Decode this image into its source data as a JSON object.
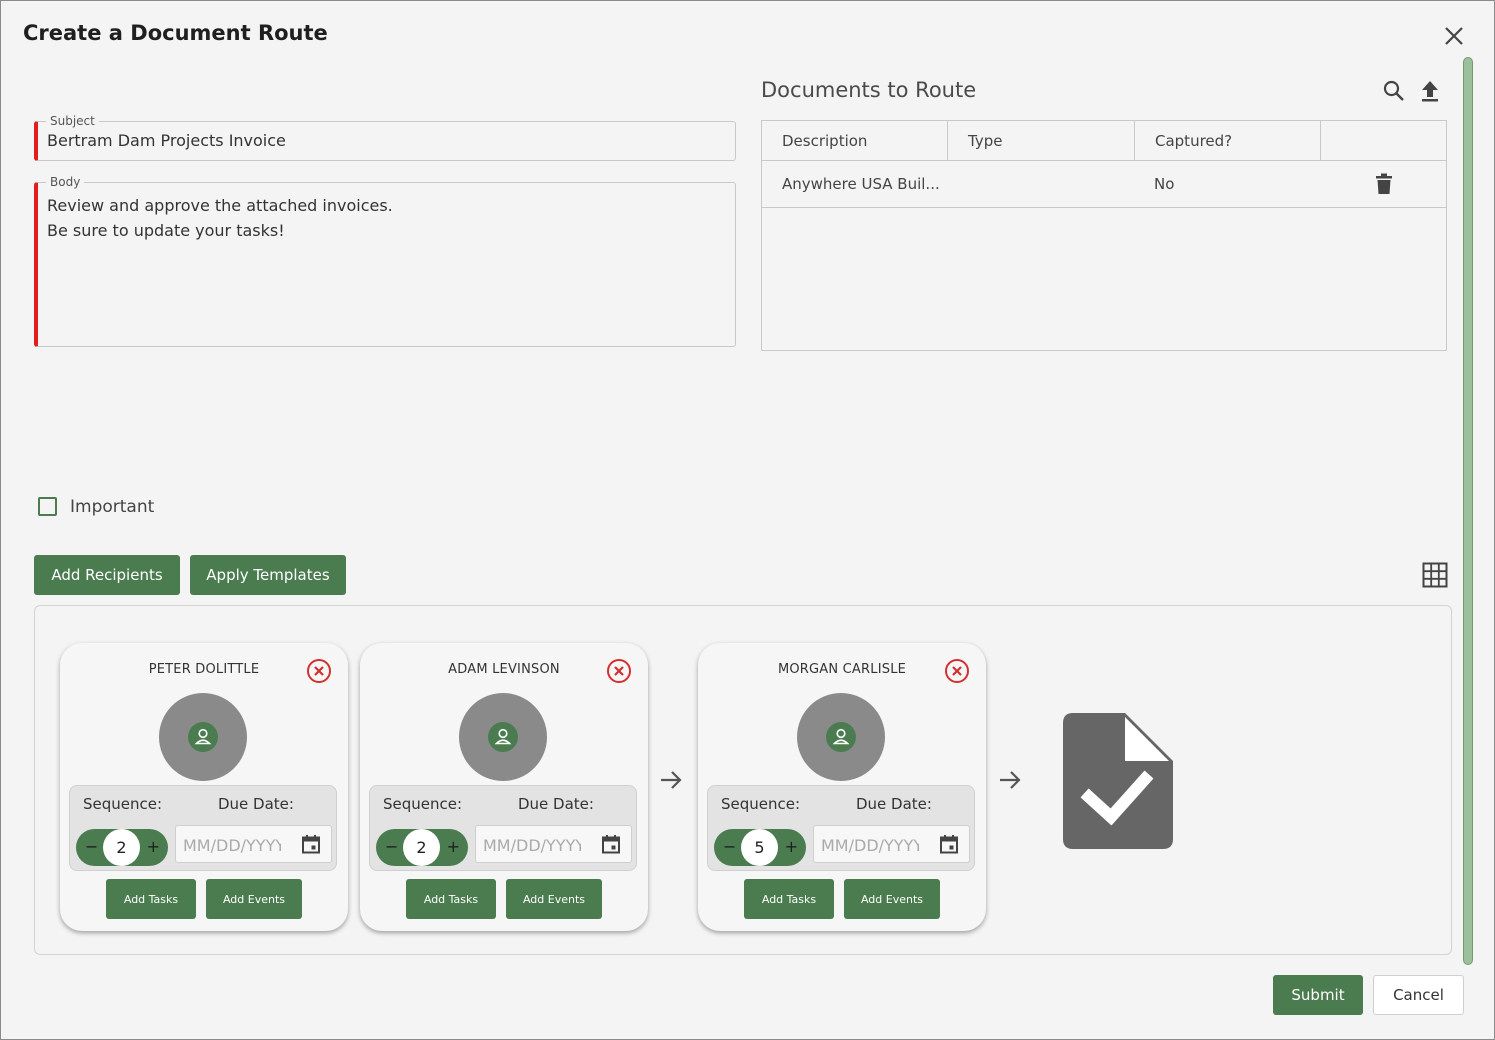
{
  "dialog": {
    "title": "Create a Document Route"
  },
  "form": {
    "subject_label": "Subject",
    "subject_value": "Bertram Dam Projects Invoice",
    "body_label": "Body",
    "body_line1": "Review and approve the attached invoices.",
    "body_line2": "Be sure to update your tasks!"
  },
  "documents": {
    "title": "Documents to Route",
    "columns": [
      "Description",
      "Type",
      "Captured?",
      ""
    ],
    "rows": [
      {
        "description": "Anywhere USA Buil...",
        "type": "",
        "captured": "No"
      }
    ]
  },
  "important": {
    "label": "Important",
    "checked": false
  },
  "actions": {
    "add_recipients": "Add Recipients",
    "apply_templates": "Apply Templates"
  },
  "recipients": [
    {
      "name": "PETER DOLITTLE",
      "sequence_label": "Sequence:",
      "due_label": "Due Date:",
      "sequence": "2",
      "date_placeholder": "MM/DD/YYYY",
      "add_tasks": "Add Tasks",
      "add_events": "Add Events"
    },
    {
      "name": "ADAM LEVINSON",
      "sequence_label": "Sequence:",
      "due_label": "Due Date:",
      "sequence": "2",
      "date_placeholder": "MM/DD/YYYY",
      "add_tasks": "Add Tasks",
      "add_events": "Add Events"
    },
    {
      "name": "MORGAN CARLISLE",
      "sequence_label": "Sequence:",
      "due_label": "Due Date:",
      "sequence": "5",
      "date_placeholder": "MM/DD/YYYY",
      "add_tasks": "Add Tasks",
      "add_events": "Add Events"
    }
  ],
  "stepper": {
    "minus": "−",
    "plus": "+"
  },
  "footer": {
    "submit": "Submit",
    "cancel": "Cancel"
  },
  "colors": {
    "accent": "#4a7c4f",
    "required": "#e11d1d",
    "remove": "#d32f2f",
    "avatar": "#8a8a8a",
    "doc_icon": "#666666"
  },
  "icons": [
    "close-icon",
    "search-icon",
    "upload-icon",
    "trash-icon",
    "grid-icon",
    "remove-circle-icon",
    "user-icon",
    "calendar-icon",
    "arrow-right-icon",
    "document-check-icon"
  ]
}
